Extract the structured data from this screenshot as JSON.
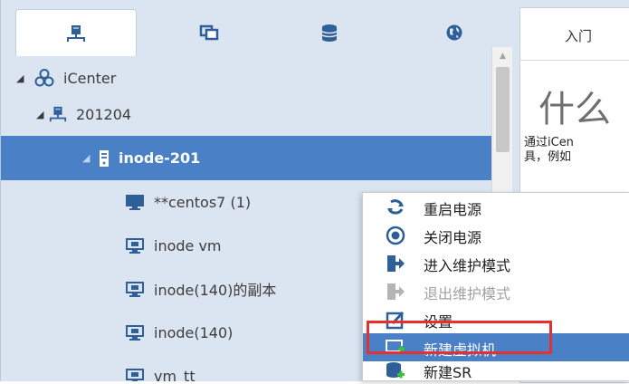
{
  "nav": {
    "tabs": [
      {
        "icon": "host-tree-icon"
      },
      {
        "icon": "copy-windows-icon"
      },
      {
        "icon": "database-icon"
      },
      {
        "icon": "globe-icon"
      }
    ],
    "tree": {
      "root": {
        "label": "iCenter",
        "icon": "cluster-icon"
      },
      "pool": {
        "label": "201204",
        "icon": "host-tree-icon"
      },
      "host": {
        "label": "inode-201",
        "icon": "server-icon"
      },
      "vms": [
        {
          "label": "**centos7 (1)",
          "icon": "vm-running-icon"
        },
        {
          "label": "inode vm",
          "icon": "vm-icon"
        },
        {
          "label": "inode(140)的副本",
          "icon": "vm-icon"
        },
        {
          "label": "inode(140)",
          "icon": "vm-icon"
        },
        {
          "label": "vm_tt",
          "icon": "vm-icon"
        }
      ]
    }
  },
  "content": {
    "tab_label": "入门",
    "big_title": "什么",
    "desc_line1": "通过iCen",
    "desc_line2": "具，例如"
  },
  "context_menu": {
    "items": [
      {
        "label": "重启电源",
        "icon": "restart-icon",
        "disabled": false,
        "highlight": false
      },
      {
        "label": "关闭电源",
        "icon": "power-off-icon",
        "disabled": false,
        "highlight": false
      },
      {
        "label": "进入维护模式",
        "icon": "enter-maintenance-icon",
        "disabled": false,
        "highlight": false
      },
      {
        "label": "退出维护模式",
        "icon": "exit-maintenance-icon",
        "disabled": true,
        "highlight": false
      },
      {
        "label": "设置",
        "icon": "settings-edit-icon",
        "disabled": false,
        "highlight": false
      },
      {
        "label": "新建虚拟机",
        "icon": "new-vm-icon",
        "disabled": false,
        "highlight": true
      },
      {
        "label": "新建SR",
        "icon": "new-sr-icon",
        "disabled": false,
        "highlight": false
      }
    ],
    "annotation_color": "#e53030"
  },
  "colors": {
    "selection": "#4a81c6",
    "panel_bg": "#dbe5f1",
    "icon_blue": "#2f5f98"
  }
}
